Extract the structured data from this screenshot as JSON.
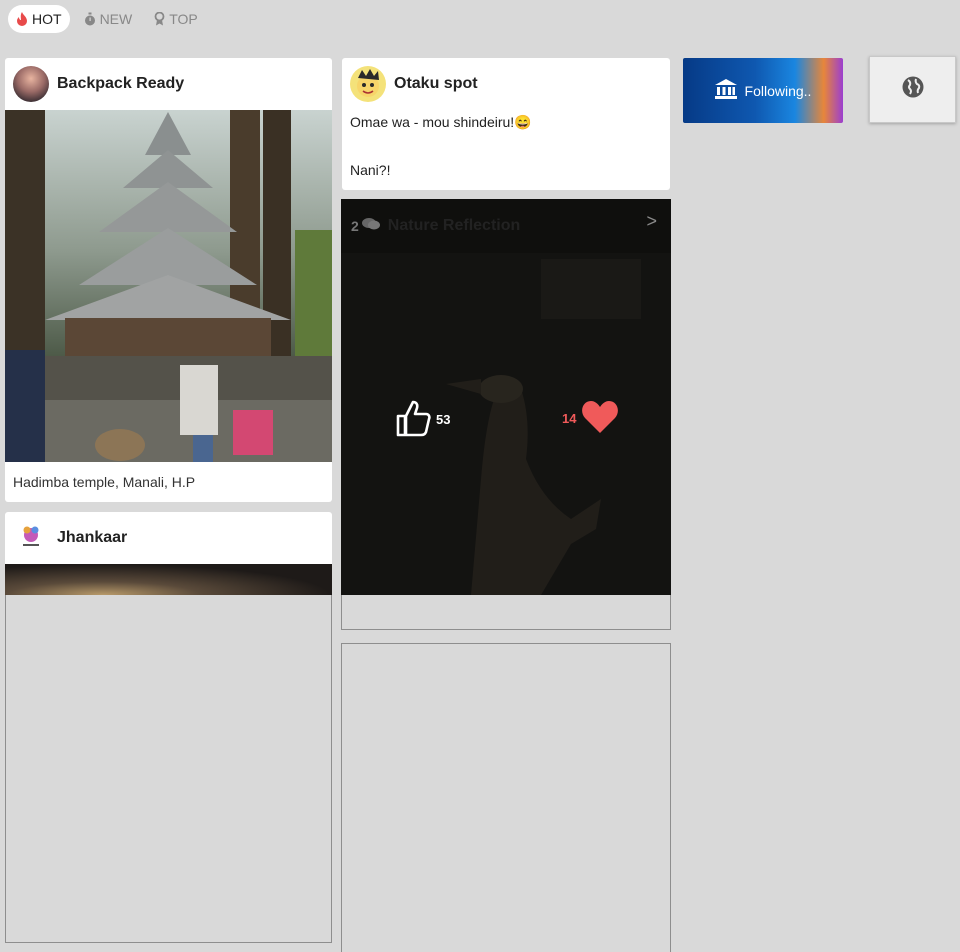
{
  "tabs": [
    {
      "label": "HOT",
      "icon": "flame-icon",
      "active": true
    },
    {
      "label": "NEW",
      "icon": "stopwatch-icon",
      "active": false
    },
    {
      "label": "TOP",
      "icon": "award-icon",
      "active": false
    }
  ],
  "posts": {
    "backpack": {
      "author": "Backpack Ready",
      "caption": "Hadimba temple, Manali, H.P"
    },
    "jhankaar": {
      "author": "Jhankaar"
    },
    "otaku": {
      "author": "Otaku spot",
      "line1": "Omae wa - mou shindeiru!😄",
      "line2": "Nani?!"
    },
    "nature": {
      "author": "Nature Reflection",
      "comments": "2",
      "likes": "53",
      "hearts": "14",
      "next": ">"
    }
  },
  "following_label": "Following..",
  "colors": {
    "accent_heart": "#f05a5a",
    "flame": "#e84a4a",
    "follow_gradient_start": "#063a86"
  }
}
